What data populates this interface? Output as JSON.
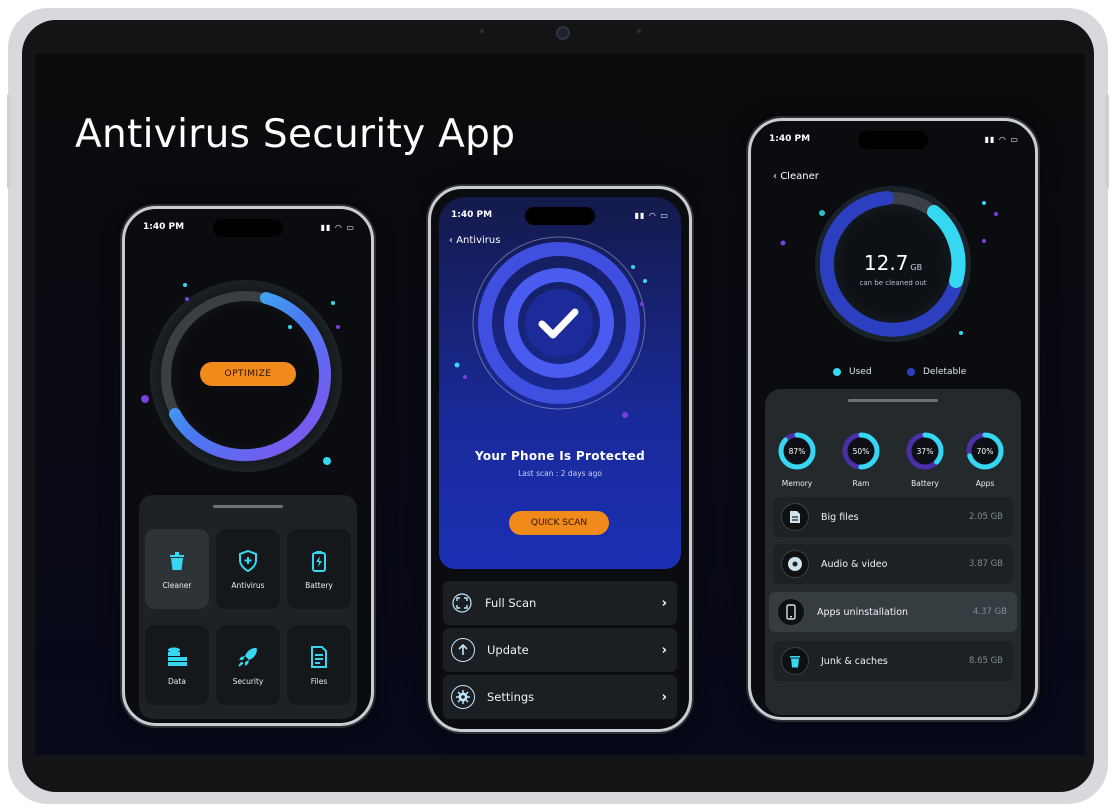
{
  "page": {
    "title": "Antivirus Security App"
  },
  "colors": {
    "accent_orange": "#f08a1b",
    "accent_cyan": "#36d7f0",
    "accent_blue": "#1a2fb3",
    "accent_purple": "#8a4ff0"
  },
  "phone1": {
    "status_time": "1:40 PM",
    "optimize_label": "OPTIMIZE",
    "tiles": [
      {
        "label": "Cleaner",
        "icon": "trash-icon"
      },
      {
        "label": "Antivirus",
        "icon": "shield-icon"
      },
      {
        "label": "Battery",
        "icon": "battery-icon"
      },
      {
        "label": "Data",
        "icon": "database-icon"
      },
      {
        "label": "Security",
        "icon": "rocket-icon"
      },
      {
        "label": "Files",
        "icon": "file-icon"
      }
    ]
  },
  "phone2": {
    "status_time": "1:40 PM",
    "back_label": "Antivirus",
    "status_title": "Your Phone Is Protected",
    "last_scan": "Last scan : 2 days ago",
    "quick_scan_label": "QUICK SCAN",
    "menu": [
      {
        "label": "Full Scan",
        "icon": "scan-icon"
      },
      {
        "label": "Update",
        "icon": "arrow-up-icon"
      },
      {
        "label": "Settings",
        "icon": "gear-icon"
      }
    ]
  },
  "phone3": {
    "status_time": "1:40 PM",
    "back_label": "Cleaner",
    "storage_value": "12.7",
    "storage_unit": "GB",
    "storage_caption": "can be cleaned out",
    "legend": [
      {
        "label": "Used",
        "color": "#36d7f0"
      },
      {
        "label": "Deletable",
        "color": "#2c3fc0"
      }
    ],
    "stats": [
      {
        "label": "Memory",
        "value": "87%",
        "fraction": 0.87
      },
      {
        "label": "Ram",
        "value": "50%",
        "fraction": 0.5
      },
      {
        "label": "Battery",
        "value": "37%",
        "fraction": 0.37
      },
      {
        "label": "Apps",
        "value": "70%",
        "fraction": 0.7
      }
    ],
    "files": [
      {
        "label": "Big files",
        "size": "2.05 GB",
        "icon": "file-icon"
      },
      {
        "label": "Audio & video",
        "size": "3.87 GB",
        "icon": "disc-icon"
      },
      {
        "label": "Apps uninstallation",
        "size": "4.37 GB",
        "icon": "phone-icon"
      },
      {
        "label": "Junk & caches",
        "size": "8.65 GB",
        "icon": "trash-icon"
      }
    ]
  }
}
